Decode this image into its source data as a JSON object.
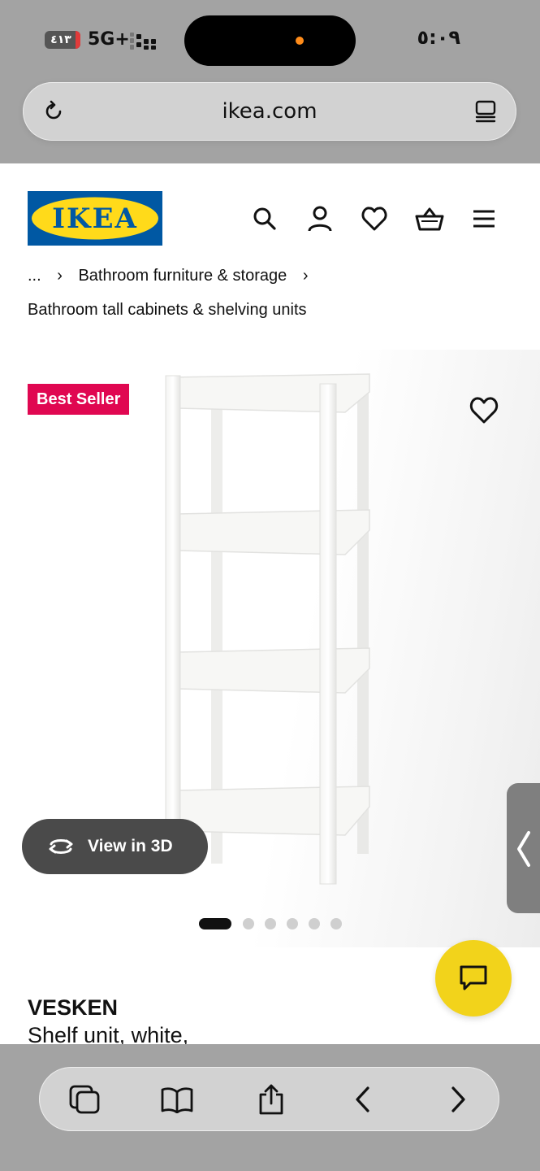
{
  "status_bar": {
    "time": "٥:٠٩",
    "battery": "٤١٣",
    "network": "5G+"
  },
  "browser": {
    "url": "ikea.com"
  },
  "breadcrumb": {
    "ellipsis": "...",
    "separator": "›",
    "item1": "Bathroom furniture & storage",
    "current": "Bathroom tall cabinets & shelving units"
  },
  "logo": {
    "text": "IKEA"
  },
  "product": {
    "badge": "Best Seller",
    "view_3d": "View in 3D",
    "name": "VESKEN",
    "description": "Shelf unit, white,",
    "image_count": 6,
    "active_image": 1
  },
  "colors": {
    "ikea_blue": "#0058a3",
    "ikea_yellow": "#ffda1a",
    "badge_red": "#e00751",
    "chat_yellow": "#f2d31b"
  }
}
